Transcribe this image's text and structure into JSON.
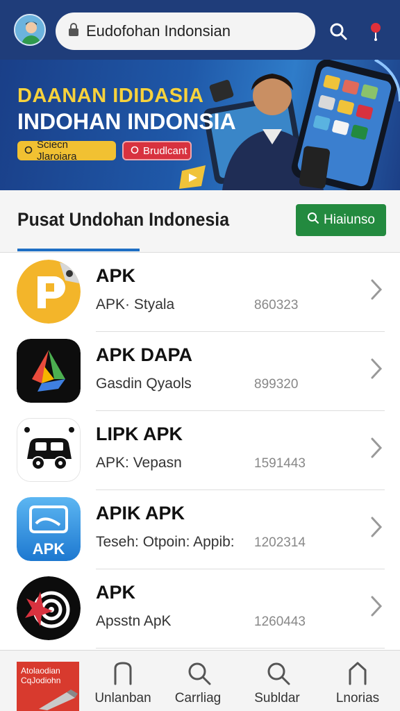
{
  "header": {
    "search_value": "Eudofohan Indonsian"
  },
  "banner": {
    "title_line1": "DAANAN IDIDASIA",
    "title_line2": "INDOHAN INDONSIA",
    "chip_left": "Sciecn Jlaroiara",
    "chip_right": "Brudlcant"
  },
  "section": {
    "title": "Pusat Undohan Indonesia",
    "button_label": "Hiaiunso"
  },
  "apps": [
    {
      "title": "APK",
      "subtitle": "APK· Styala",
      "number": "860323"
    },
    {
      "title": "APK DAPA",
      "subtitle": "Gasdin Qyaols",
      "number": "899320"
    },
    {
      "title": "LIPK APK",
      "subtitle": "APK: Vepasn",
      "number": "1591443"
    },
    {
      "title": "APIK APK",
      "subtitle": "Teseh: Otpoin: Appib:",
      "number": "1202314"
    },
    {
      "title": "APK",
      "subtitle": "Apsstn ApK",
      "number": "1260443"
    }
  ],
  "app_icon_label": "APK",
  "nav": {
    "promo_text": "Atolaodian CqJodiohn",
    "items": [
      {
        "label": "Unlanban",
        "icon": "bookmark-icon"
      },
      {
        "label": "Carrliag",
        "icon": "search-icon"
      },
      {
        "label": "Subldar",
        "icon": "search-icon"
      },
      {
        "label": "Lnorias",
        "icon": "bookmark-icon"
      }
    ]
  },
  "colors": {
    "header_bg": "#1f3d7a",
    "accent_green": "#238a3f",
    "accent_blue": "#1f6fc4"
  }
}
